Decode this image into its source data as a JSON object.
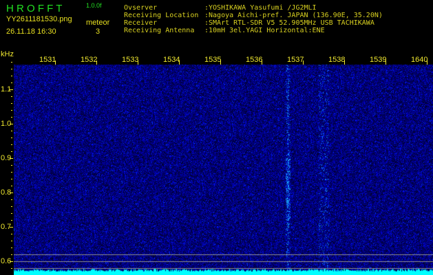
{
  "header": {
    "logo": "H R O F F T",
    "version": "1.0.0f",
    "filename": "YY2611181530.png",
    "datetime": "26.11.18 16:30",
    "meteor_label": "meteor",
    "meteor_count": "3",
    "info": [
      {
        "label": "Ovserver",
        "value": ":YOSHIKAWA Yasufumi /JG2MLI"
      },
      {
        "label": "Receiving Location",
        "value": ":Nagoya Aichi-pref. JAPAN (136.90E, 35.20N)"
      },
      {
        "label": "Receiver",
        "value": ":SMArt RTL-SDR V5 52.905MHz USB TACHIKAWA"
      },
      {
        "label": "Receiving Antenna",
        "value": ":10mH 3el.YAGI Horizontal:ENE"
      }
    ]
  },
  "spectrogram": {
    "unit": "kHz",
    "freq_labels": [
      "1531",
      "1532",
      "1533",
      "1534",
      "1535",
      "1536",
      "1537",
      "1538",
      "1539",
      "1640"
    ],
    "y_labels": [
      "1.1",
      "1.0",
      "0.9",
      "0.8",
      "0.7",
      "0.6"
    ],
    "colors": {
      "background": "#0a0a60",
      "noise": "#2040ff",
      "bright": "#40e0ff",
      "baseline": "#00ffff"
    }
  }
}
